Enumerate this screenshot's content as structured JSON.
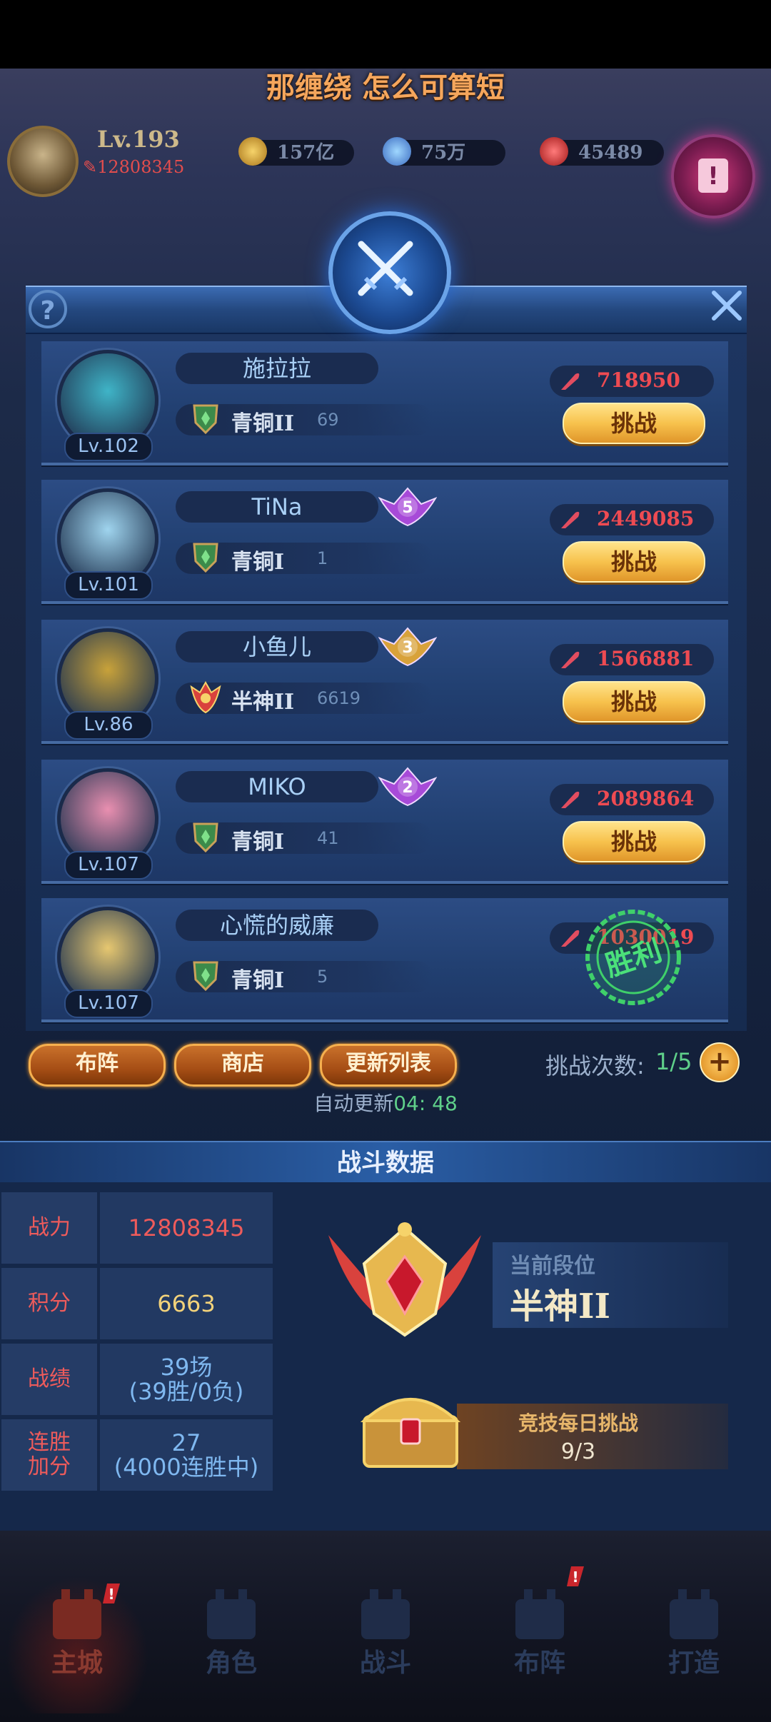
{
  "subtitle": "那缠绕 怎么可算短",
  "player": {
    "level": "Lv.193",
    "power": "12808345"
  },
  "resources": {
    "gold": "157亿",
    "diamond": "75万",
    "ruby": "45489"
  },
  "icons": {
    "help": "question-icon",
    "close": "close-icon",
    "emblem": "crossed-swords-icon",
    "quest": "quest-scroll-icon",
    "power": "quill-icon",
    "plus": "plus-icon"
  },
  "opponents": [
    {
      "name": "施拉拉",
      "level": "Lv.102",
      "rank": "青铜II",
      "rank_points": "69",
      "power": "718950",
      "action": "挑战",
      "portrait_color": "#3fb4c7"
    },
    {
      "name": "TiNa",
      "level": "Lv.101",
      "rank": "青铜I",
      "rank_points": "1",
      "power": "2449085",
      "action": "挑战",
      "medal": "5",
      "portrait_color": "#9fd4ee"
    },
    {
      "name": "小鱼儿",
      "level": "Lv.86",
      "rank": "半神II",
      "rank_points": "6619",
      "power": "1566881",
      "action": "挑战",
      "medal": "3",
      "portrait_color": "#c8a23a"
    },
    {
      "name": "MIKO",
      "level": "Lv.107",
      "rank": "青铜I",
      "rank_points": "41",
      "power": "2089864",
      "action": "挑战",
      "medal": "2",
      "portrait_color": "#e98fb0"
    },
    {
      "name": "心慌的威廉",
      "level": "Lv.107",
      "rank": "青铜I",
      "rank_points": "5",
      "power": "1030019",
      "action": "",
      "stamp": "胜利",
      "portrait_color": "#e6c770"
    }
  ],
  "actions": {
    "formation": "布阵",
    "shop": "商店",
    "refresh": "更新列表"
  },
  "challenges": {
    "label": "挑战次数:",
    "value": "1/5"
  },
  "auto_refresh": {
    "label": "自动更新",
    "time": "04:  48"
  },
  "battle_data": {
    "title": "战斗数据",
    "rows": [
      {
        "label": "战力",
        "value": "12808345",
        "value2": ""
      },
      {
        "label": "积分",
        "value": "6663",
        "value2": ""
      },
      {
        "label": "战绩",
        "value": "39场",
        "value2": "(39胜/0负)"
      },
      {
        "label": "连胜加分",
        "value": "27",
        "value2": "(4000连胜中)"
      }
    ],
    "current_rank_label": "当前段位",
    "current_rank": "半神II",
    "daily_label": "竞技每日挑战",
    "daily_value": "9/3"
  },
  "nav": [
    "主城",
    "角色",
    "战斗",
    "布阵",
    "打造"
  ],
  "colors": {
    "accent_red": "#ee4b52",
    "gold": "#f7c24d",
    "green": "#5fd08a"
  }
}
